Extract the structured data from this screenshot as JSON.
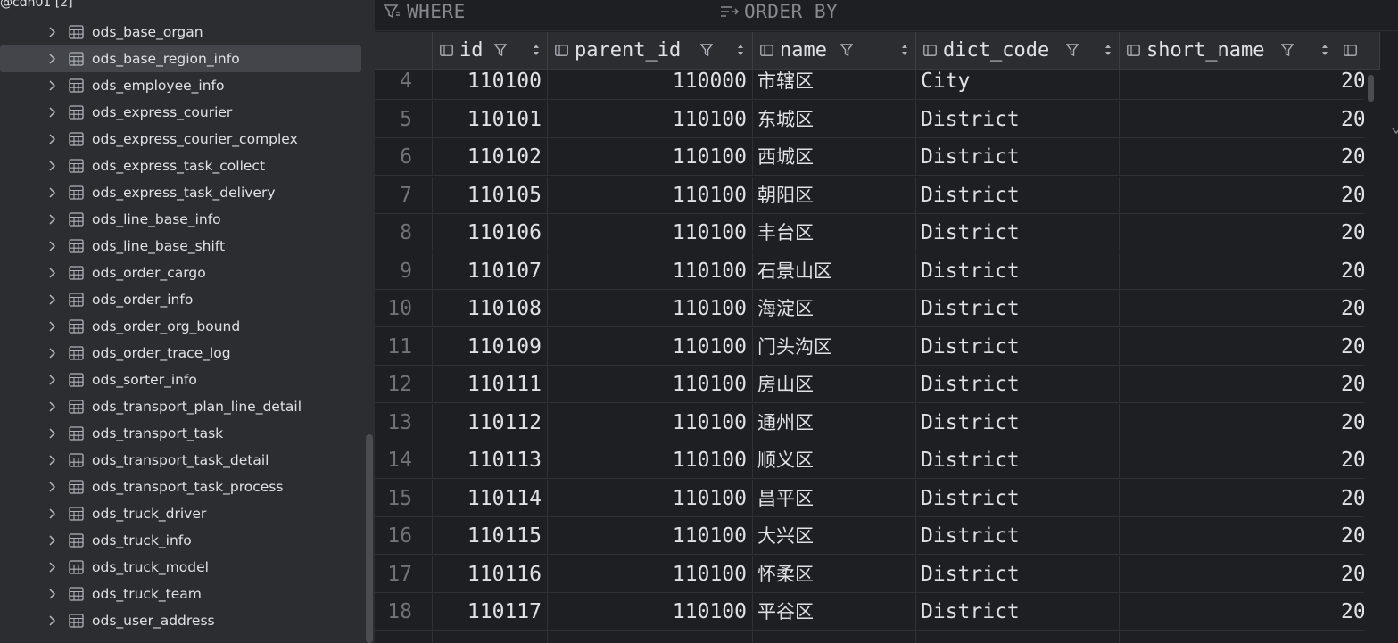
{
  "sidebar": {
    "root_label": "@cdh01 [2]",
    "items": [
      {
        "label": "ods_base_organ",
        "selected": false
      },
      {
        "label": "ods_base_region_info",
        "selected": true
      },
      {
        "label": "ods_employee_info",
        "selected": false
      },
      {
        "label": "ods_express_courier",
        "selected": false
      },
      {
        "label": "ods_express_courier_complex",
        "selected": false
      },
      {
        "label": "ods_express_task_collect",
        "selected": false
      },
      {
        "label": "ods_express_task_delivery",
        "selected": false
      },
      {
        "label": "ods_line_base_info",
        "selected": false
      },
      {
        "label": "ods_line_base_shift",
        "selected": false
      },
      {
        "label": "ods_order_cargo",
        "selected": false
      },
      {
        "label": "ods_order_info",
        "selected": false
      },
      {
        "label": "ods_order_org_bound",
        "selected": false
      },
      {
        "label": "ods_order_trace_log",
        "selected": false
      },
      {
        "label": "ods_sorter_info",
        "selected": false
      },
      {
        "label": "ods_transport_plan_line_detail",
        "selected": false
      },
      {
        "label": "ods_transport_task",
        "selected": false
      },
      {
        "label": "ods_transport_task_detail",
        "selected": false
      },
      {
        "label": "ods_transport_task_process",
        "selected": false
      },
      {
        "label": "ods_truck_driver",
        "selected": false
      },
      {
        "label": "ods_truck_info",
        "selected": false
      },
      {
        "label": "ods_truck_model",
        "selected": false
      },
      {
        "label": "ods_truck_team",
        "selected": false
      },
      {
        "label": "ods_user_address",
        "selected": false
      }
    ]
  },
  "filter_bar": {
    "where_label": "WHERE",
    "order_by_label": "ORDER BY"
  },
  "grid": {
    "columns": [
      {
        "name": "id"
      },
      {
        "name": "parent_id"
      },
      {
        "name": "name"
      },
      {
        "name": "dict_code"
      },
      {
        "name": "short_name"
      },
      {
        "name": ""
      }
    ],
    "rows": [
      {
        "rn": "4",
        "id": "110100",
        "parent_id": "110000",
        "name": "市辖区",
        "dict_code": "City",
        "short_name": "",
        "extra": "20"
      },
      {
        "rn": "5",
        "id": "110101",
        "parent_id": "110100",
        "name": "东城区",
        "dict_code": "District",
        "short_name": "",
        "extra": "20"
      },
      {
        "rn": "6",
        "id": "110102",
        "parent_id": "110100",
        "name": "西城区",
        "dict_code": "District",
        "short_name": "",
        "extra": "20"
      },
      {
        "rn": "7",
        "id": "110105",
        "parent_id": "110100",
        "name": "朝阳区",
        "dict_code": "District",
        "short_name": "",
        "extra": "20"
      },
      {
        "rn": "8",
        "id": "110106",
        "parent_id": "110100",
        "name": "丰台区",
        "dict_code": "District",
        "short_name": "",
        "extra": "20"
      },
      {
        "rn": "9",
        "id": "110107",
        "parent_id": "110100",
        "name": "石景山区",
        "dict_code": "District",
        "short_name": "",
        "extra": "20"
      },
      {
        "rn": "10",
        "id": "110108",
        "parent_id": "110100",
        "name": "海淀区",
        "dict_code": "District",
        "short_name": "",
        "extra": "20"
      },
      {
        "rn": "11",
        "id": "110109",
        "parent_id": "110100",
        "name": "门头沟区",
        "dict_code": "District",
        "short_name": "",
        "extra": "20"
      },
      {
        "rn": "12",
        "id": "110111",
        "parent_id": "110100",
        "name": "房山区",
        "dict_code": "District",
        "short_name": "",
        "extra": "20"
      },
      {
        "rn": "13",
        "id": "110112",
        "parent_id": "110100",
        "name": "通州区",
        "dict_code": "District",
        "short_name": "",
        "extra": "20"
      },
      {
        "rn": "14",
        "id": "110113",
        "parent_id": "110100",
        "name": "顺义区",
        "dict_code": "District",
        "short_name": "",
        "extra": "20"
      },
      {
        "rn": "15",
        "id": "110114",
        "parent_id": "110100",
        "name": "昌平区",
        "dict_code": "District",
        "short_name": "",
        "extra": "20"
      },
      {
        "rn": "16",
        "id": "110115",
        "parent_id": "110100",
        "name": "大兴区",
        "dict_code": "District",
        "short_name": "",
        "extra": "20"
      },
      {
        "rn": "17",
        "id": "110116",
        "parent_id": "110100",
        "name": "怀柔区",
        "dict_code": "District",
        "short_name": "",
        "extra": "20"
      },
      {
        "rn": "18",
        "id": "110117",
        "parent_id": "110100",
        "name": "平谷区",
        "dict_code": "District",
        "short_name": "",
        "extra": "20"
      }
    ]
  },
  "icons": {
    "tree_expand": "chevron-right-icon",
    "table": "table-icon",
    "filter": "filter-icon",
    "sort": "sort-icon",
    "column": "column-icon",
    "where": "filter-funnel-icon",
    "order_by": "sort-lines-icon"
  },
  "colors": {
    "sidebar_bg": "#2b2d30",
    "grid_bg": "#1e1f22",
    "selection": "#43454a",
    "text": "#dfe1e5",
    "muted": "#6f737a"
  }
}
